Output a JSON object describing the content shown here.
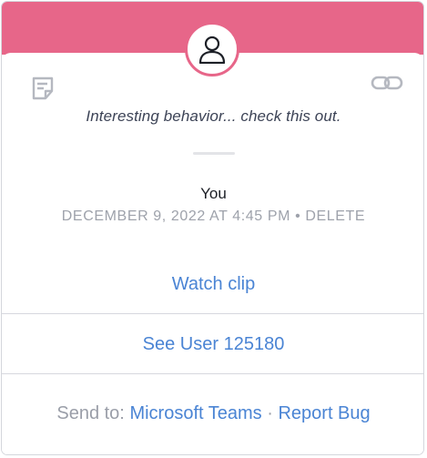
{
  "banner": {
    "color": "#e76689"
  },
  "avatar": {
    "icon": "user-icon"
  },
  "icons": {
    "note": "note-icon",
    "link": "link-icon"
  },
  "message": "Interesting behavior... check this out.",
  "author": "You",
  "meta": {
    "timestamp": "DECEMBER 9, 2022 AT 4:45 PM",
    "separator": "•",
    "delete_label": "DELETE"
  },
  "actions": {
    "watch_clip": "Watch clip",
    "see_user": "See User 125180"
  },
  "send_to": {
    "label": "Send to:",
    "teams": "Microsoft Teams",
    "separator": "·",
    "report_bug": "Report Bug"
  },
  "colors": {
    "accent": "#e76689",
    "link": "#4a84d4",
    "muted": "#9ea2ab"
  }
}
